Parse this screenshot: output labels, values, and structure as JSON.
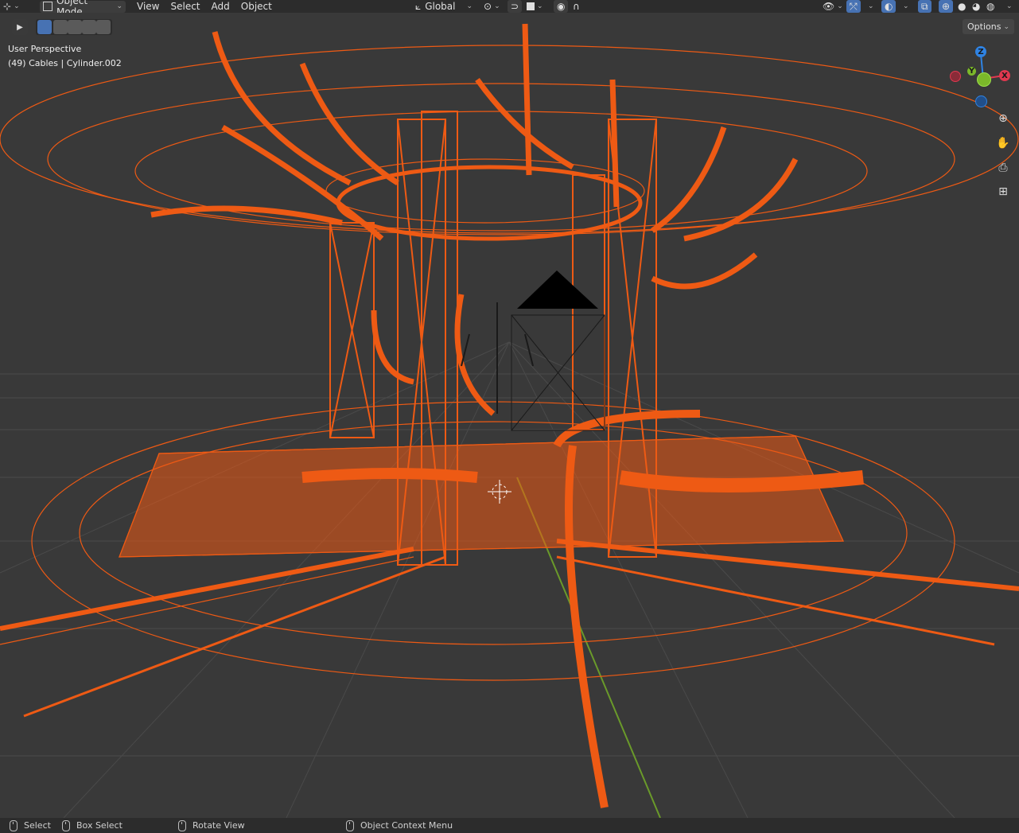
{
  "header": {
    "mode_label": "Object Mode",
    "menus": [
      "View",
      "Select",
      "Add",
      "Object"
    ],
    "transform_orientation": "Global"
  },
  "toolbar": {
    "options_label": "Options"
  },
  "viewport": {
    "perspective_label": "User Perspective",
    "object_info": "(49) Cables | Cylinder.002"
  },
  "gizmo": {
    "z": "Z",
    "y": "Y",
    "x": "X"
  },
  "status": {
    "select": "Select",
    "box_select": "Box Select",
    "rotate_view": "Rotate View",
    "context_menu": "Object Context Menu"
  },
  "colors": {
    "wire": "#ee5a14",
    "bg": "#393939",
    "grid": "#4a4a4a",
    "axis_x": "#e0384f",
    "axis_y": "#7bb82a",
    "axis_z": "#2f83e3"
  }
}
